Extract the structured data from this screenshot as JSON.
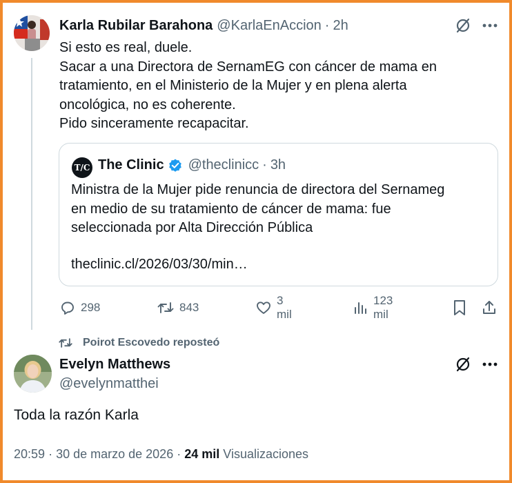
{
  "tweet1": {
    "author_name": "Karla Rubilar Barahona",
    "author_handle": "@KarlaEnAccion",
    "separator": "·",
    "time": "2h",
    "text_lines": [
      "Si esto es real, duele.",
      "Sacar a una Directora de SernamEG con cáncer de mama en",
      "tratamiento, en el Ministerio de la Mujer y en plena alerta",
      "oncológica, no es coherente.",
      "Pido sinceramente recapacitar."
    ],
    "quote": {
      "logo_text": "T/C",
      "author_name": "The Clinic",
      "author_handle": "@theclinicc",
      "separator": "·",
      "time": "3h",
      "text_lines": [
        "Ministra de la Mujer pide renuncia de directora del Sernameg",
        "en medio de su tratamiento de cáncer de mama: fue",
        "seleccionada por Alta Dirección Pública"
      ],
      "link": "theclinic.cl/2026/03/30/min…"
    },
    "actions": {
      "replies": "298",
      "reposts": "843",
      "likes": "3 mil",
      "views": "123 mil"
    }
  },
  "repost_notice": "Poirot Escovedo reposteó",
  "tweet2": {
    "author_name": "Evelyn Matthews",
    "author_handle": "@evelynmatthei",
    "text": "Toda la razón Karla",
    "meta_time": "20:59",
    "meta_sep1": "·",
    "meta_date": "30 de marzo de 2026",
    "meta_sep2": "·",
    "meta_views_count": "24 mil",
    "meta_views_label": "Visualizaciones"
  },
  "colors": {
    "frame": "#f08a2c",
    "text": "#0f1419",
    "muted": "#536471",
    "verified": "#1d9bf0",
    "border": "#cfd9de"
  },
  "icons": [
    "grok-icon",
    "more-icon",
    "verified-badge-icon",
    "reply-icon",
    "repost-icon",
    "like-icon",
    "views-icon",
    "bookmark-icon",
    "share-icon"
  ]
}
